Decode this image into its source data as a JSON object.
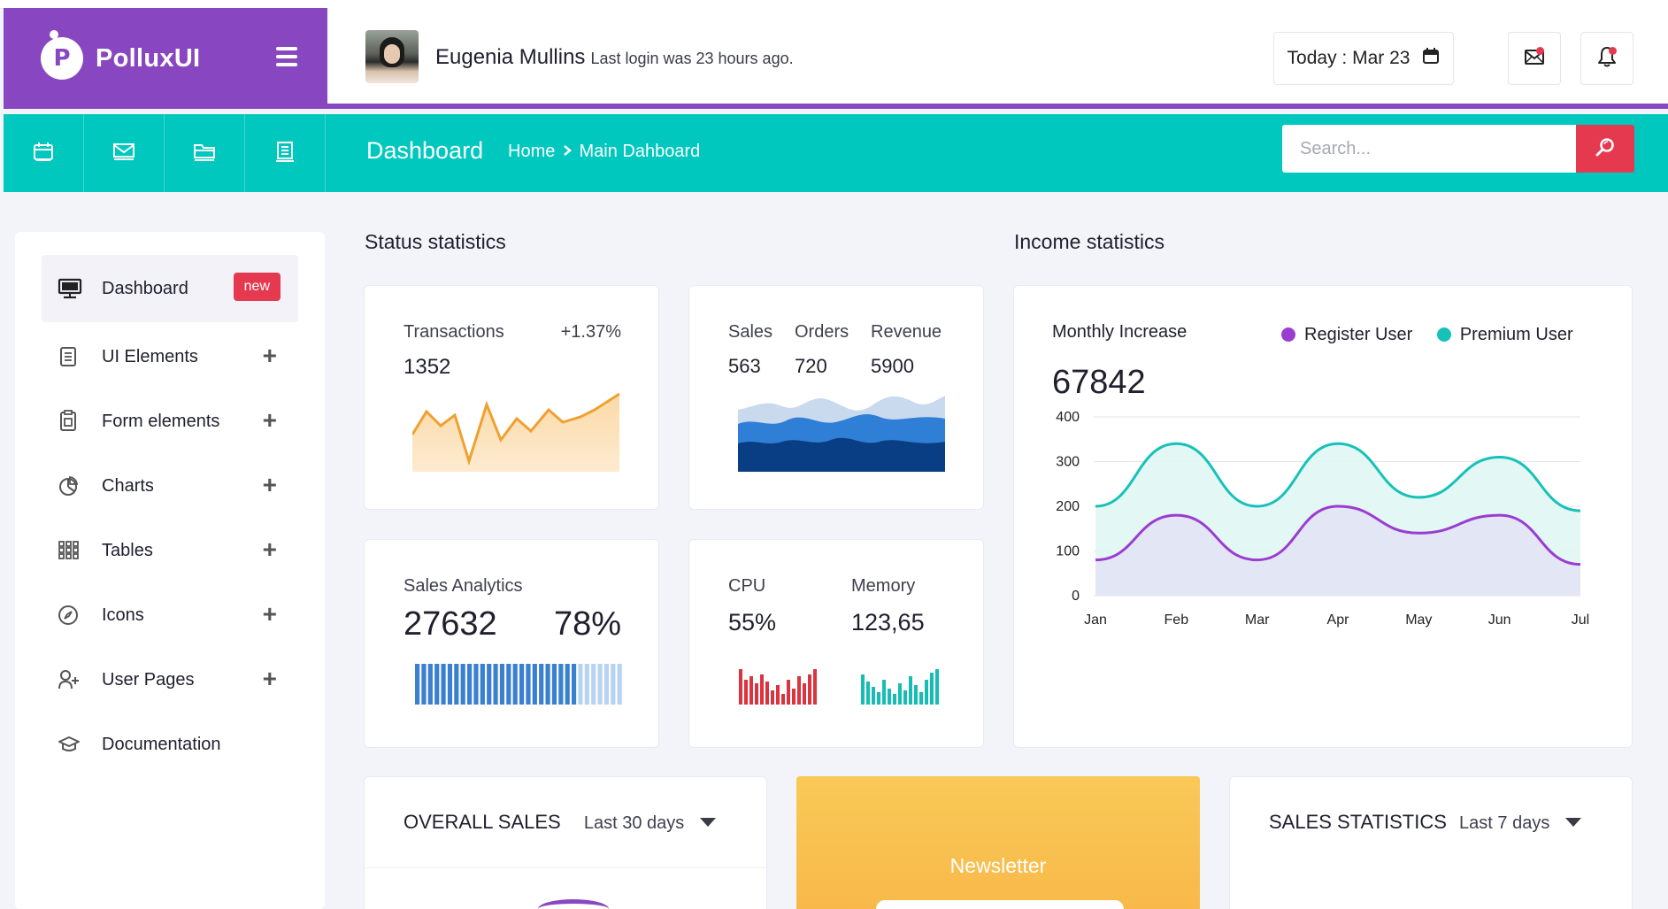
{
  "brand": {
    "logo_letter": "P",
    "name": "PolluxUI"
  },
  "header": {
    "user_name": "Eugenia Mullins",
    "last_login": "Last login was 23 hours ago.",
    "date": "Today : Mar 23"
  },
  "subbar": {
    "page_title": "Dashboard",
    "crumb_home": "Home",
    "crumb_current": "Main Dahboard",
    "search_placeholder": "Search..."
  },
  "sidebar": {
    "items": [
      {
        "label": "Dashboard",
        "icon": "monitor-icon",
        "badge": "new"
      },
      {
        "label": "UI Elements",
        "icon": "document-icon"
      },
      {
        "label": "Form elements",
        "icon": "form-icon"
      },
      {
        "label": "Charts",
        "icon": "pie-chart-icon"
      },
      {
        "label": "Tables",
        "icon": "grid-icon"
      },
      {
        "label": "Icons",
        "icon": "compass-icon"
      },
      {
        "label": "User Pages",
        "icon": "user-add-icon"
      },
      {
        "label": "Documentation",
        "icon": "graduation-cap-icon"
      }
    ]
  },
  "status": {
    "title": "Status statistics",
    "transactions": {
      "label": "Transactions",
      "change": "+1.37%",
      "value": "1352"
    },
    "sales_orders": {
      "sales_label": "Sales",
      "sales_value": "563",
      "orders_label": "Orders",
      "orders_value": "720",
      "revenue_label": "Revenue",
      "revenue_value": "5900"
    },
    "analytics": {
      "label": "Sales Analytics",
      "value": "27632",
      "percent": "78%",
      "progress": 0.78
    },
    "cpu": {
      "cpu_label": "CPU",
      "cpu_value": "55%",
      "mem_label": "Memory",
      "mem_value": "123,65"
    }
  },
  "income": {
    "title": "Income statistics",
    "card_label": "Monthly Increase",
    "value": "67842"
  },
  "bottom": {
    "overall_sales": {
      "title": "OVERALL SALES",
      "range": "Last 30 days"
    },
    "newsletter": "Newsletter",
    "sales_statistics": {
      "title": "SALES STATISTICS",
      "range": "Last 7 days"
    }
  },
  "colors": {
    "brand_purple": "#8847c1",
    "teal": "#00c8bf",
    "red": "#e53950",
    "orange": "#f5a623",
    "blue": "#2f7fd6",
    "register": "#9b3dd1",
    "premium": "#16c2b8"
  },
  "chart_data": {
    "type": "line",
    "title": "",
    "xlabel": "",
    "ylabel": "",
    "categories": [
      "Jan",
      "Feb",
      "Mar",
      "Apr",
      "May",
      "Jun",
      "Jul"
    ],
    "ylim": [
      0,
      400
    ],
    "yticks": [
      0,
      100,
      200,
      300,
      400
    ],
    "grid": true,
    "legend": "top-right",
    "series": [
      {
        "name": "Register User",
        "color": "#9b3dd1",
        "values": [
          80,
          180,
          80,
          200,
          140,
          180,
          70
        ]
      },
      {
        "name": "Premium User",
        "color": "#16c2b8",
        "values": [
          200,
          340,
          200,
          340,
          220,
          310,
          190
        ]
      }
    ]
  }
}
